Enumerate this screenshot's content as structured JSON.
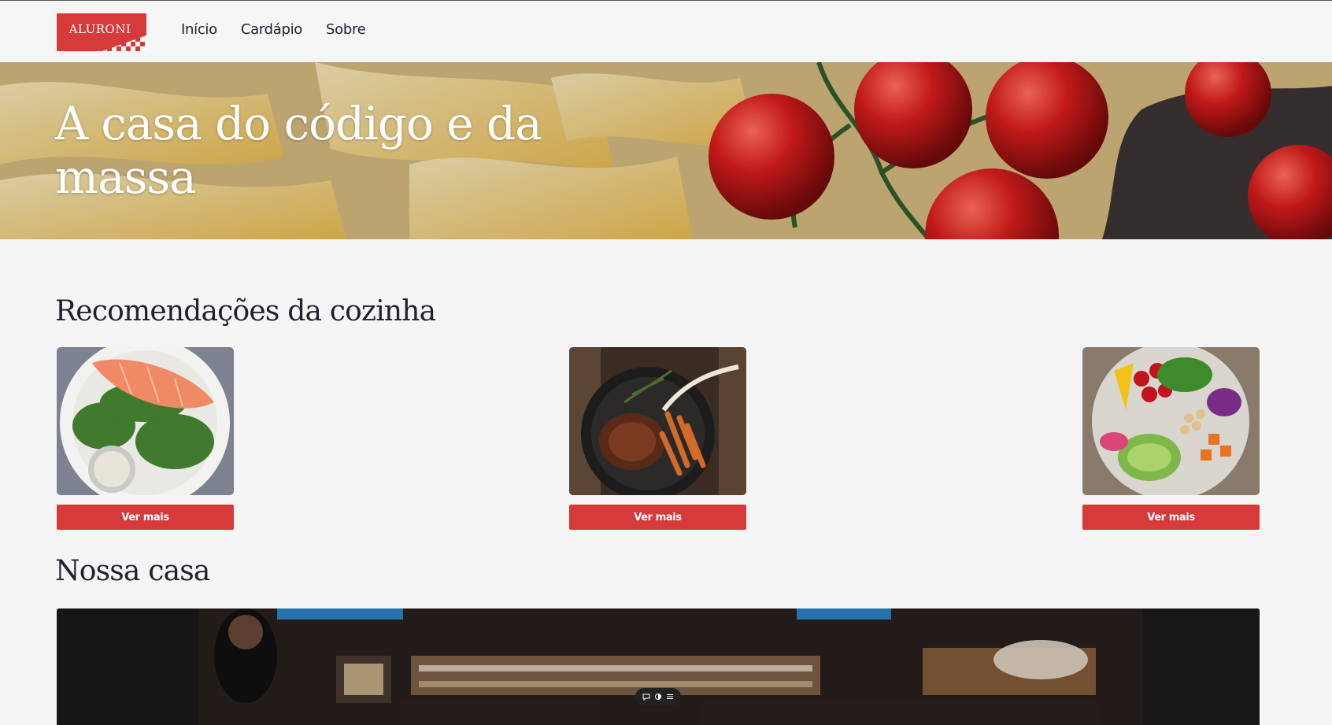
{
  "header": {
    "logo_text": "ALURONI",
    "nav": [
      {
        "label": "Início"
      },
      {
        "label": "Cardápio"
      },
      {
        "label": "Sobre"
      }
    ]
  },
  "hero": {
    "title": "A casa do código e da massa"
  },
  "recommendations": {
    "title": "Recomendações da cozinha",
    "cards": [
      {
        "image": "salmon-salad-dish",
        "button_label": "Ver mais"
      },
      {
        "image": "steak-with-fries-skillet",
        "button_label": "Ver mais"
      },
      {
        "image": "vegetable-bowl-dish",
        "button_label": "Ver mais"
      }
    ]
  },
  "house": {
    "title": "Nossa casa",
    "image": "restaurant-interior"
  },
  "colors": {
    "accent": "#d63a3b",
    "background": "#f6f5f5",
    "text": "#1f2030"
  }
}
